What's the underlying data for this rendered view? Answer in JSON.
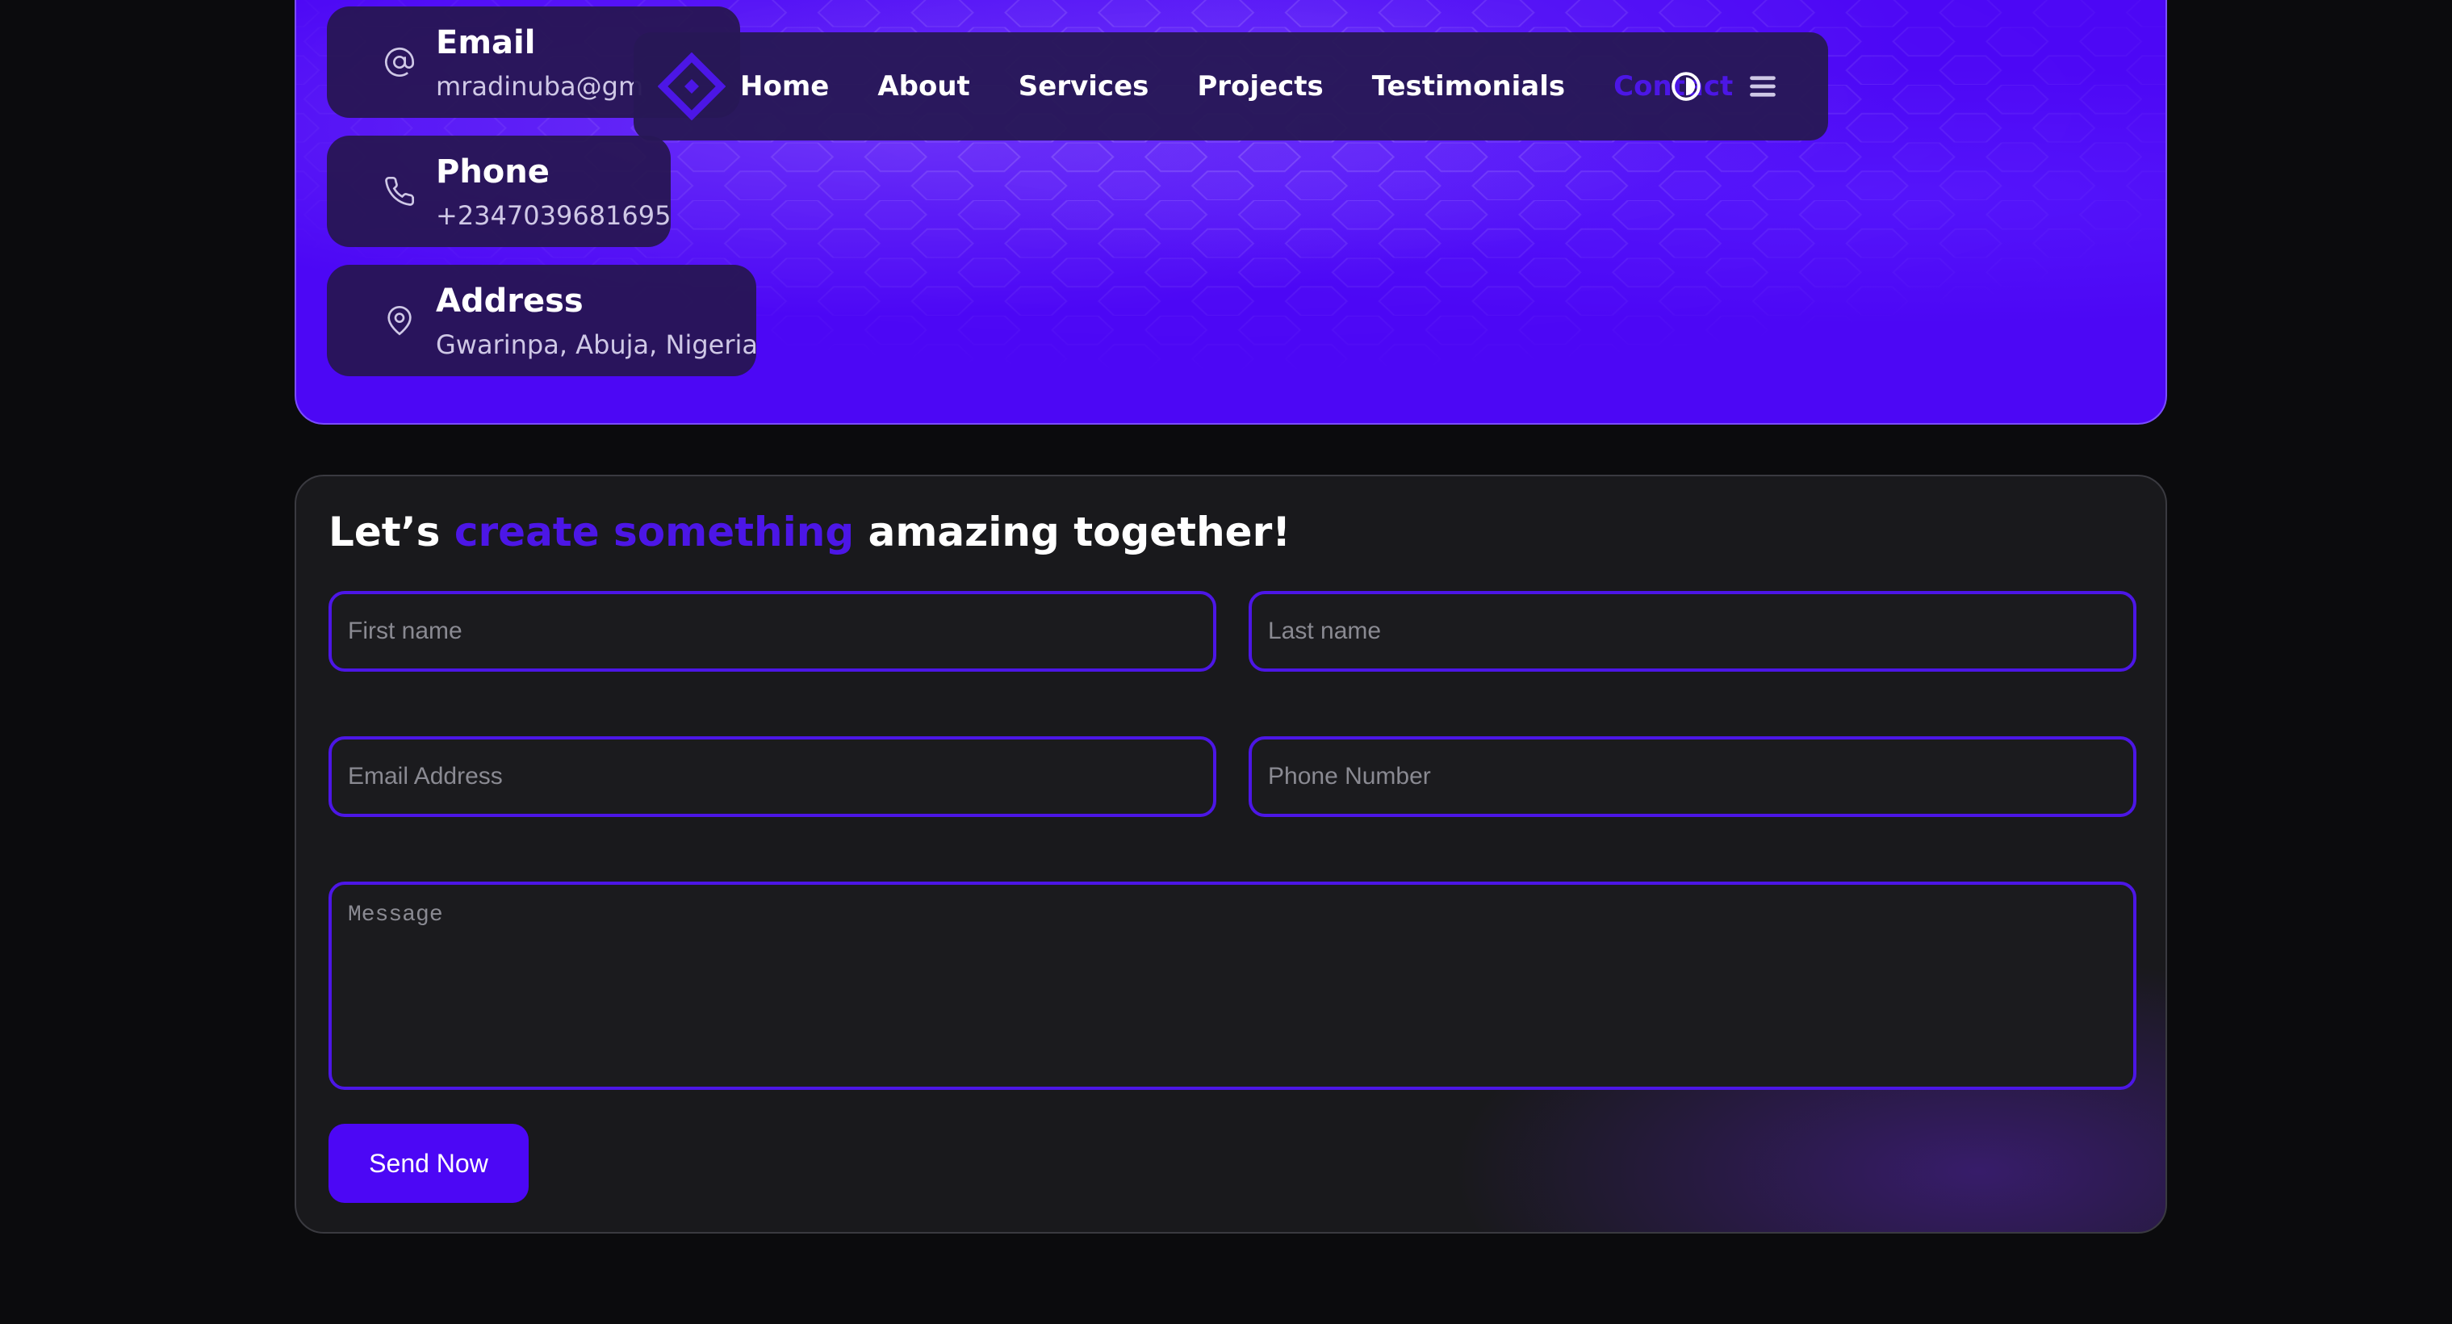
{
  "contact_cards": [
    {
      "icon": "at-icon",
      "title": "Email",
      "value": "mradinuba@gmail.com"
    },
    {
      "icon": "phone-icon",
      "title": "Phone",
      "value": "+2347039681695"
    },
    {
      "icon": "location-pin-icon",
      "title": "Address",
      "value": "Gwarinpa, Abuja, Nigeria"
    }
  ],
  "nav": {
    "logo_icon": "diamond-logo-icon",
    "links": [
      "Home",
      "About",
      "Services",
      "Projects",
      "Testimonials",
      "Contact"
    ],
    "active_link": "Contact",
    "theme_icon": "theme-toggle-icon",
    "menu_icon": "hamburger-menu-icon"
  },
  "form": {
    "headline_pre": "Let’s",
    "headline_accent": "create something",
    "headline_post": "amazing together!",
    "first_name_placeholder": "First name",
    "last_name_placeholder": "Last name",
    "email_placeholder": "Email Address",
    "phone_placeholder": "Phone Number",
    "message_placeholder": "Message",
    "submit_label": "Send Now"
  },
  "colors": {
    "accent": "#4c07f5",
    "accent_text": "#4c16e6",
    "page_background": "#0b0b0d",
    "panel_background": "#19191c",
    "card_background": "#26164e"
  }
}
